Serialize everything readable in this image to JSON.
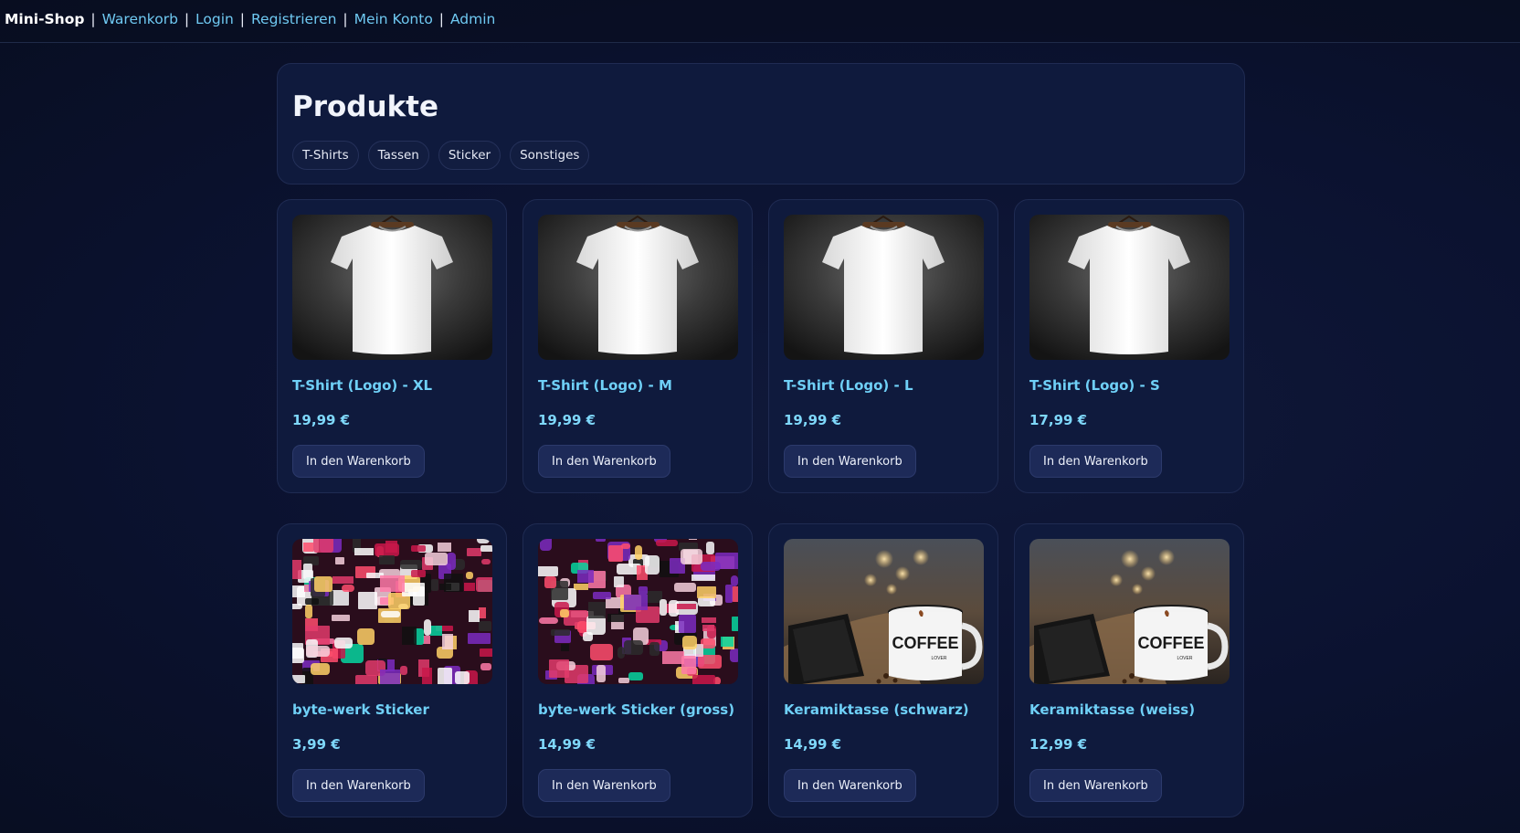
{
  "nav": {
    "brand": "Mini-Shop",
    "links": [
      "Warenkorb",
      "Login",
      "Registrieren",
      "Mein Konto",
      "Admin"
    ],
    "separator": "|"
  },
  "page": {
    "title": "Produkte",
    "categories": [
      "T-Shirts",
      "Tassen",
      "Sticker",
      "Sonstiges"
    ]
  },
  "products": [
    {
      "name": "T-Shirt (Logo) - XL",
      "price": "19,99 €",
      "button": "In den Warenkorb",
      "image": "tshirt-image"
    },
    {
      "name": "T-Shirt (Logo) - M",
      "price": "19,99 €",
      "button": "In den Warenkorb",
      "image": "tshirt-image"
    },
    {
      "name": "T-Shirt (Logo) - L",
      "price": "19,99 €",
      "button": "In den Warenkorb",
      "image": "tshirt-image"
    },
    {
      "name": "T-Shirt (Logo) - S",
      "price": "17,99 €",
      "button": "In den Warenkorb",
      "image": "tshirt-image"
    },
    {
      "name": "byte-werk Sticker",
      "price": "3,99 €",
      "button": "In den Warenkorb",
      "image": "sticker-image"
    },
    {
      "name": "byte-werk Sticker (gross)",
      "price": "14,99 €",
      "button": "In den Warenkorb",
      "image": "sticker-image"
    },
    {
      "name": "Keramiktasse (schwarz)",
      "price": "14,99 €",
      "button": "In den Warenkorb",
      "image": "mug-image"
    },
    {
      "name": "Keramiktasse (weiss)",
      "price": "12,99 €",
      "button": "In den Warenkorb",
      "image": "mug-image"
    }
  ],
  "mug_print": {
    "line1": "COFFEE",
    "line2": "LOVER"
  },
  "colors": {
    "background": "#0b1230",
    "card": "#0f1a3d",
    "accent": "#6fd0f7",
    "button": "#1d2a58"
  }
}
